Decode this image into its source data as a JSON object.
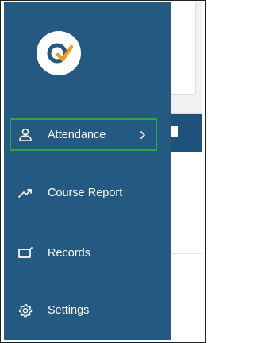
{
  "sidebar": {
    "logo_icon": "q-check-logo-icon",
    "items": [
      {
        "label": "Attendance",
        "icon": "person-icon",
        "active": true,
        "has_chevron": true
      },
      {
        "label": "Course Report",
        "icon": "trend-up-icon",
        "active": false,
        "has_chevron": false
      },
      {
        "label": "Records",
        "icon": "folder-icon",
        "active": false,
        "has_chevron": false
      },
      {
        "label": "Settings",
        "icon": "gear-icon",
        "active": false,
        "has_chevron": false
      }
    ]
  },
  "colors": {
    "sidebar_bg": "#245a82",
    "active_border": "#27a84a",
    "logo_orange": "#f39a1f",
    "logo_blue": "#245a82"
  }
}
